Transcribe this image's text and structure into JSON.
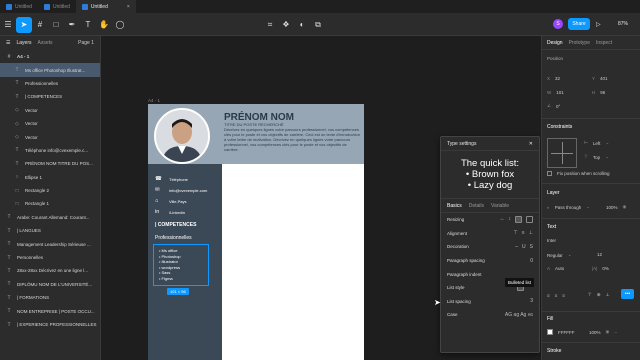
{
  "tabs": [
    {
      "label": "Untitled",
      "active": false
    },
    {
      "label": "Untitled",
      "active": false
    },
    {
      "label": "Untitled",
      "active": true
    }
  ],
  "header": {
    "share_label": "Share",
    "avatar_initial": "S",
    "zoom": "87%"
  },
  "left_panel": {
    "tab_layers": "Layers",
    "tab_assets": "Assets",
    "page": "Page 1",
    "frame": "A4 - 1",
    "layers": [
      {
        "label": "Ms office Photoshop Illustrat...",
        "icon": "T",
        "selected": true,
        "indent": true
      },
      {
        "label": "Professionnelles",
        "icon": "T",
        "selected": false,
        "indent": true
      },
      {
        "label": "| COMPETENCES",
        "icon": "T",
        "selected": false,
        "indent": true
      },
      {
        "label": "Vector",
        "icon": "◇",
        "selected": false,
        "indent": true
      },
      {
        "label": "Vector",
        "icon": "◇",
        "selected": false,
        "indent": true
      },
      {
        "label": "Vector",
        "icon": "◇",
        "selected": false,
        "indent": true
      },
      {
        "label": "Téléphone info@cvexemple.c...",
        "icon": "T",
        "selected": false,
        "indent": true
      },
      {
        "label": "PRÉNOM NOM TITRE DU POS...",
        "icon": "T",
        "selected": false,
        "indent": true
      },
      {
        "label": "Ellipse 1",
        "icon": "○",
        "selected": false,
        "indent": true
      },
      {
        "label": "Rectangle 2",
        "icon": "□",
        "selected": false,
        "indent": true
      },
      {
        "label": "Rectangle 1",
        "icon": "□",
        "selected": false,
        "indent": true
      },
      {
        "label": "Arabe: Courant Allemand: Courant...",
        "icon": "T",
        "selected": false,
        "indent": false
      },
      {
        "label": "| LANGUES",
        "icon": "T",
        "selected": false,
        "indent": false
      },
      {
        "label": "Management Leadership Sérieuse ...",
        "icon": "T",
        "selected": false,
        "indent": false
      },
      {
        "label": "Personnelles",
        "icon": "T",
        "selected": false,
        "indent": false
      },
      {
        "label": "28xx-28xx Décrivez en une ligne l...",
        "icon": "T",
        "selected": false,
        "indent": false
      },
      {
        "label": "DIPLÔMU NOM DE L'UNIVERSITÉ...",
        "icon": "T",
        "selected": false,
        "indent": false
      },
      {
        "label": "| FORMATIONS",
        "icon": "T",
        "selected": false,
        "indent": false
      },
      {
        "label": "NOM ENTREPRISE | POSTE OCCU...",
        "icon": "T",
        "selected": false,
        "indent": false
      },
      {
        "label": "| EXPERIENCE PROFESSIONNELLES",
        "icon": "T",
        "selected": false,
        "indent": false
      }
    ]
  },
  "canvas": {
    "frame_label": "A4 - 1",
    "name": "PRÉNOM NOM",
    "title": "TITRE DU POSTE RECHERCHÉ",
    "paragraph": "Décrivez en quelques lignes votre parcours professionnel, vos compétences clés pour le poste et vos objectifs de carrière. Ceci est un texte d'introduction à votre lettre de motivation. Décrivez en quelques lignes votre parcours professionnel, vos compétences clés pour le poste et vos objectifs de carrière.",
    "contacts": [
      {
        "icon": "phone-icon",
        "glyph": "☎",
        "text": "Téléphone"
      },
      {
        "icon": "mail-icon",
        "glyph": "✉",
        "text": "info@cvexemple.com"
      },
      {
        "icon": "location-icon",
        "glyph": "⌂",
        "text": "Ville,Pays"
      },
      {
        "icon": "linkedin-icon",
        "glyph": "in",
        "text": "/Linkedin"
      }
    ],
    "section1": "| COMPETENCES",
    "section2": "Professionnelles",
    "bullets": [
      "Ms office",
      "Photoshop",
      "Illustrator",
      "wordpress",
      "Sass",
      "Figma"
    ],
    "selection_size": "101 × 96"
  },
  "type_settings": {
    "title": "Type settings",
    "preview_heading": "The quick list:",
    "preview_items": [
      "Brown fox",
      "Lazy dog"
    ],
    "tabs": [
      "Basics",
      "Details",
      "Variable"
    ],
    "rows": [
      {
        "label": "Resizing"
      },
      {
        "label": "Alignment"
      },
      {
        "label": "Decoration"
      },
      {
        "label": "Paragraph spacing",
        "value": "0"
      },
      {
        "label": "Paragraph indent"
      },
      {
        "label": "List style"
      },
      {
        "label": "List spacing",
        "value": "3"
      },
      {
        "label": "Case",
        "value": "AG  ag  Ag  ᴀɢ"
      }
    ],
    "tooltip": "Bulleted list"
  },
  "right_panel": {
    "tabs": [
      "Design",
      "Prototype",
      "Inspect"
    ],
    "position": "Position",
    "x": "32",
    "y": "401",
    "w": "101",
    "h": "96",
    "rotation": "0°",
    "constraints": "Constraints",
    "constraint_h": "Left",
    "constraint_v": "Top",
    "fix_label": "Fix position when scrolling",
    "layer": "Layer",
    "blend": "Pass through",
    "layer_opacity": "100%",
    "text": "Text",
    "font": "Inter",
    "weight": "Regular",
    "font_size": "12",
    "line_height": "Auto",
    "letter_spacing": "0%",
    "fill": "Fill",
    "fill_hex": "FFFFFF",
    "fill_opacity": "100%",
    "stroke": "Stroke"
  }
}
